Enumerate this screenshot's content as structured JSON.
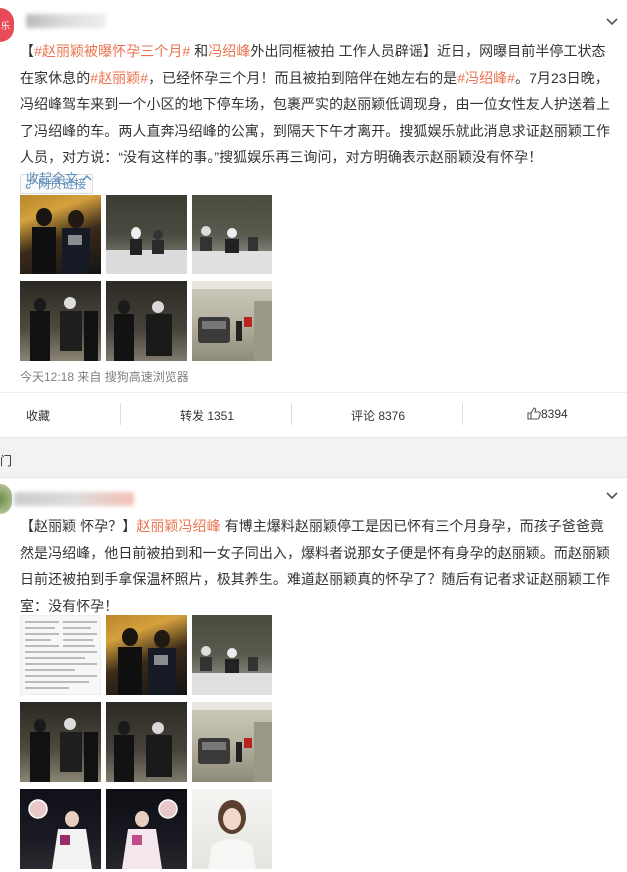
{
  "post1": {
    "avatar_text": "乐",
    "topic_tag": "#赵丽颖被曝怀孕三个月#",
    "topic_tag2": "#冯绍峰#",
    "text_parts": [
      {
        "t": "【",
        "h": false
      },
      {
        "t": "#赵丽颖被曝怀孕三个月#",
        "h": true
      },
      {
        "t": " 和",
        "h": false
      },
      {
        "t": "冯绍峰",
        "h": true
      },
      {
        "t": "外出同框被拍 工作人员辟谣】近日，网曝目前半停工状态在家休息的",
        "h": false
      },
      {
        "t": "#赵丽颖#",
        "h": true
      },
      {
        "t": "，已经怀孕三个月！而且被拍到陪伴在她左右的是",
        "h": false
      },
      {
        "t": "#冯绍峰#",
        "h": true
      },
      {
        "t": "。7月23日晚，冯绍峰驾车来到一个小区的地下停车场，包裹严实的赵丽颖低调现身，由一位女性友人护送着上了冯绍峰的车。两人直奔冯绍峰的公寓，到隔天下午才离开。搜狐娱乐就此消息求证赵丽颖工作人员，对方说：“没有这样的事。”搜狐娱乐再三询问，对方明确表示赵丽颖没有怀孕！",
        "h": false
      }
    ],
    "link_chip": "网页链接",
    "collapse_label": "收起全文",
    "meta": "今天12:18 来自 搜狗高速浏览器",
    "actions": {
      "favorite": "收藏",
      "repost": "转发 1351",
      "comment": "评论 8376",
      "like": "8394"
    }
  },
  "divider_tag": "门",
  "post2": {
    "text_parts": [
      {
        "t": "【赵丽颖 怀孕？】",
        "h": false
      },
      {
        "t": "赵丽颖冯绍峰",
        "h": true
      },
      {
        "t": " 有博主爆料赵丽颖停工是因已怀有三个月身孕，而孩子爸爸竟然是冯绍峰，他日前被拍到和一女子同出入，爆料者说那女子便是怀有身孕的赵丽颖。而赵丽颖日前还被拍到手拿保温杯照片，极其养生。难道赵丽颖真的怀孕了？随后有记者求证赵丽颖工作室：没有怀孕！",
        "h": false
      }
    ]
  },
  "colors": {
    "accent": "#eb7350",
    "link": "#5f8ebc",
    "divider_bg": "#f2f2f5"
  }
}
